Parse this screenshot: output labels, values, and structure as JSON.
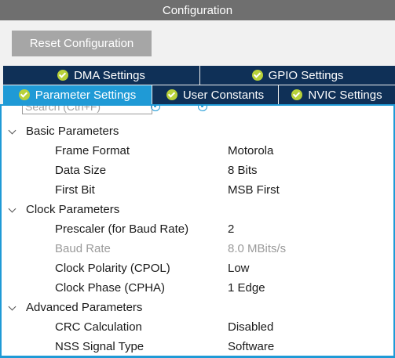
{
  "panel": {
    "title": "Configuration"
  },
  "toolbar": {
    "reset_label": "Reset Configuration"
  },
  "tabs": {
    "row1": [
      {
        "label": "DMA Settings",
        "status": "ok"
      },
      {
        "label": "GPIO Settings",
        "status": "ok"
      }
    ],
    "row2": [
      {
        "label": "Parameter Settings",
        "status": "ok",
        "active": true
      },
      {
        "label": "User Constants",
        "status": "ok"
      },
      {
        "label": "NVIC Settings",
        "status": "ok"
      }
    ]
  },
  "search": {
    "placeholder": "Search (Ctrl+F)"
  },
  "colors": {
    "accent": "#1f9ad6",
    "tab_bg": "#0f3057",
    "title_bg": "#6f6f6f",
    "check": "#b8d13a"
  },
  "groups": [
    {
      "label": "Basic Parameters",
      "params": [
        {
          "name": "Frame Format",
          "value": "Motorola",
          "enabled": true
        },
        {
          "name": "Data Size",
          "value": "8 Bits",
          "enabled": true
        },
        {
          "name": "First Bit",
          "value": "MSB First",
          "enabled": true
        }
      ]
    },
    {
      "label": "Clock Parameters",
      "params": [
        {
          "name": "Prescaler (for Baud Rate)",
          "value": "2",
          "enabled": true
        },
        {
          "name": "Baud Rate",
          "value": "8.0 MBits/s",
          "enabled": false
        },
        {
          "name": "Clock Polarity (CPOL)",
          "value": "Low",
          "enabled": true
        },
        {
          "name": "Clock Phase (CPHA)",
          "value": "1 Edge",
          "enabled": true
        }
      ]
    },
    {
      "label": "Advanced Parameters",
      "params": [
        {
          "name": "CRC Calculation",
          "value": "Disabled",
          "enabled": true
        },
        {
          "name": "NSS Signal Type",
          "value": "Software",
          "enabled": true
        }
      ]
    }
  ]
}
